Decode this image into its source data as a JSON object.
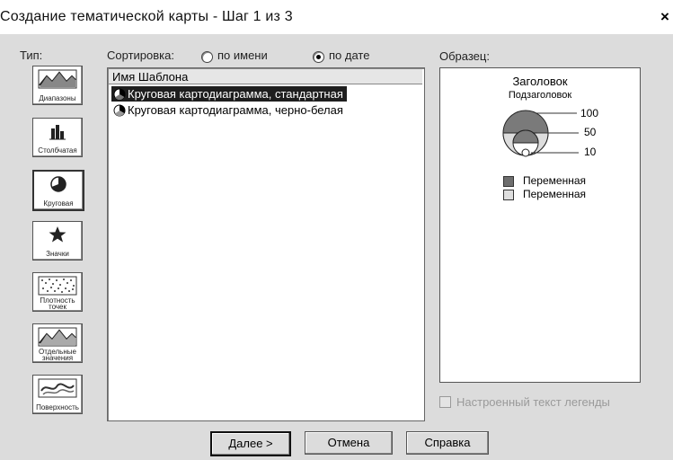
{
  "window": {
    "title": "Создание тематической карты - Шаг 1 из 3",
    "close": "×"
  },
  "type": {
    "label": "Тип:",
    "buttons": [
      {
        "caption": "Диапазоны",
        "icon": "ranges-icon"
      },
      {
        "caption": "Столбчатая",
        "icon": "bar-chart-icon"
      },
      {
        "caption": "Круговая",
        "icon": "pie-chart-icon",
        "selected": true
      },
      {
        "caption": "Значки",
        "icon": "star-icon"
      },
      {
        "caption": "Плотность точек",
        "icon": "dot-density-icon"
      },
      {
        "caption": "Отдельные значения",
        "icon": "individual-values-icon"
      },
      {
        "caption": "Поверхность",
        "icon": "surface-icon"
      }
    ]
  },
  "sort": {
    "label": "Сортировка:",
    "by_name": "по имени",
    "by_date": "по дате",
    "selected": "by_date"
  },
  "templates": {
    "header": "Имя Шаблона",
    "items": [
      {
        "label": "Круговая картодиаграмма, стандартная",
        "selected": true
      },
      {
        "label": "Круговая картодиаграмма, черно-белая",
        "selected": false
      }
    ]
  },
  "preview": {
    "label": "Образец:",
    "title": "Заголовок",
    "subtitle": "Подзаголовок",
    "sizes": [
      "100",
      "50",
      "10"
    ],
    "legend": [
      {
        "label": "Переменная",
        "color": "#6e6e6e"
      },
      {
        "label": "Переменная",
        "color": "#dedede"
      }
    ]
  },
  "custom_legend": {
    "label": "Настроенный текст легенды",
    "checked": false,
    "enabled": false
  },
  "buttons": {
    "next": "Далее >",
    "cancel": "Отмена",
    "help": "Справка"
  }
}
